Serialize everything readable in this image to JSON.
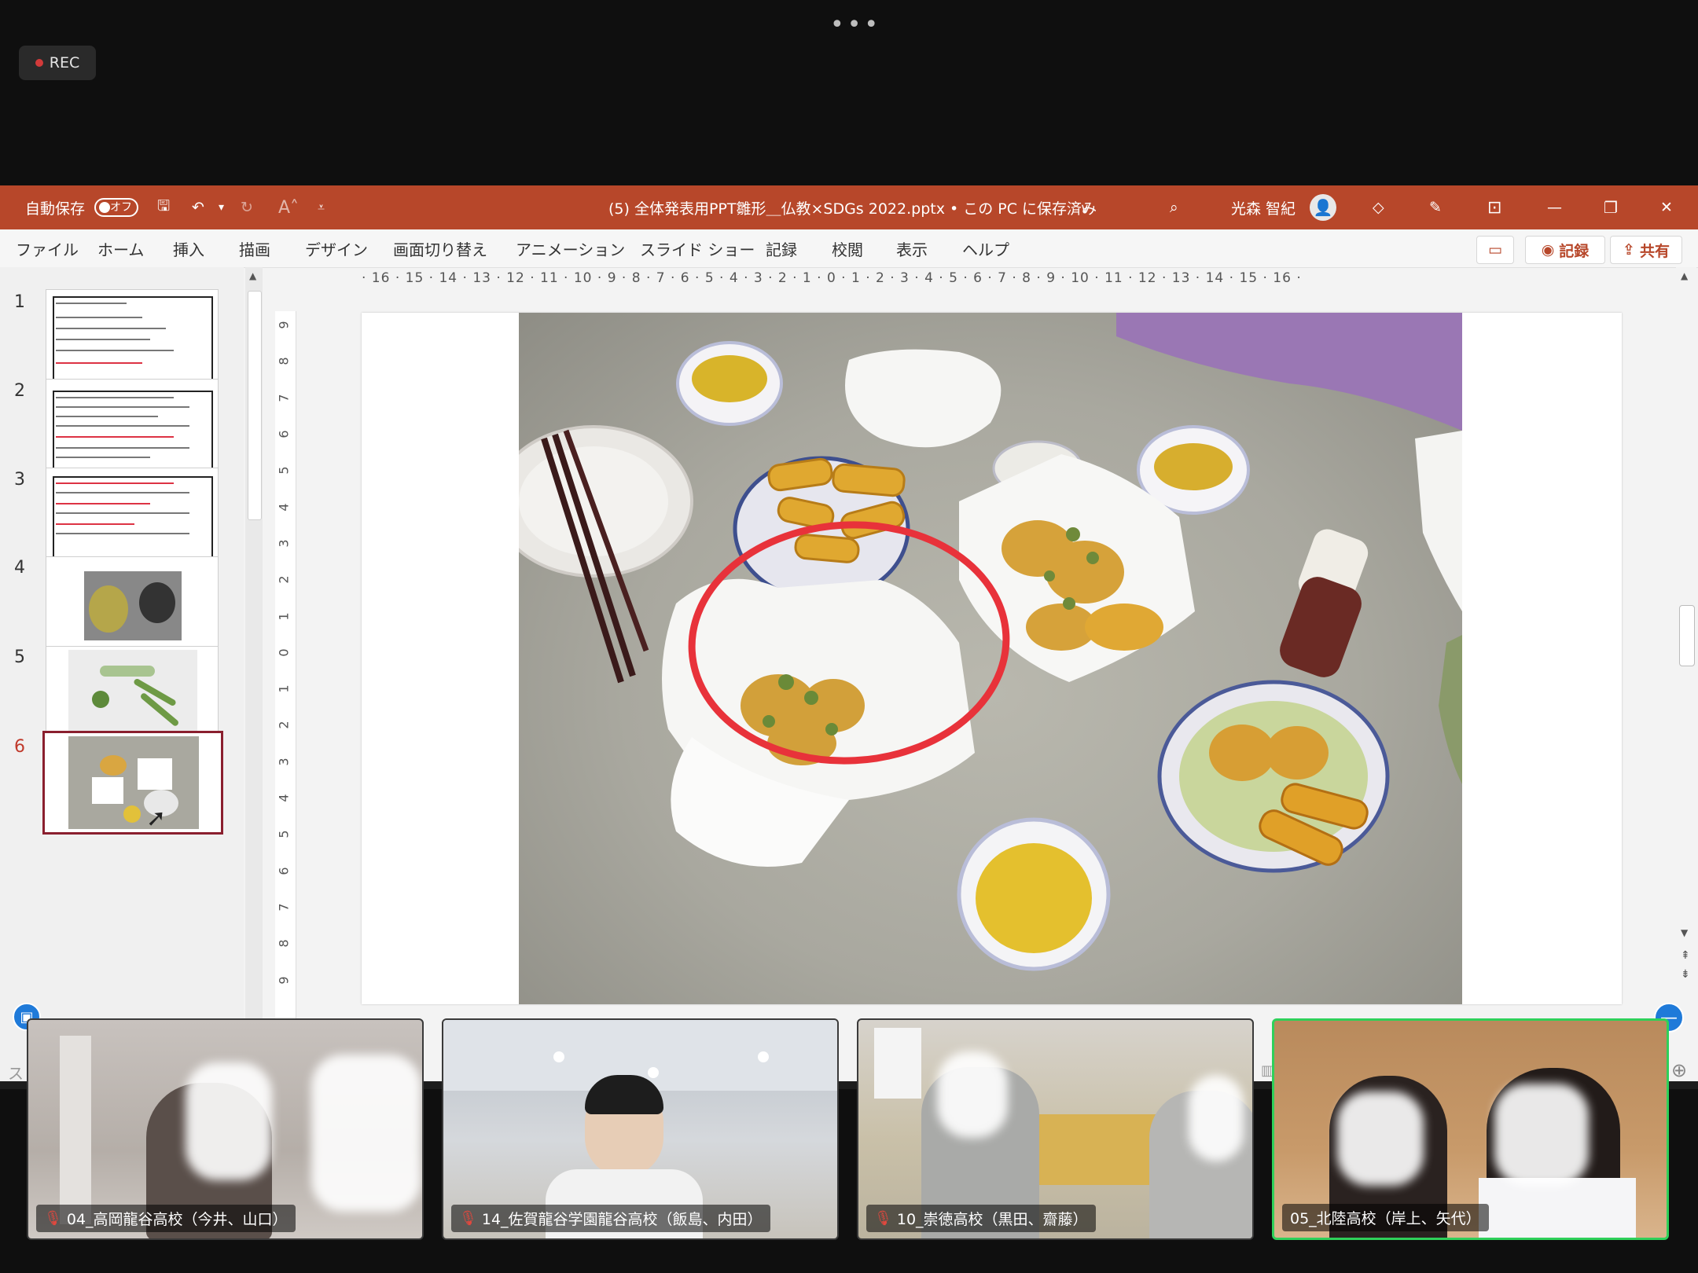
{
  "meeting": {
    "more_icon": "more-dots-icon",
    "more_label": "•••",
    "rec_label": "REC"
  },
  "titlebar": {
    "autosave_label": "自動保存",
    "autosave_state": "オフ",
    "doc_title": "(5) 全体発表用PPT雛形＿仏教×SDGs 2022.pptx • この PC に保存済み",
    "user_name": "光森 智紀"
  },
  "menu": {
    "items": [
      "ファイル",
      "ホーム",
      "挿入",
      "描画",
      "デザイン",
      "画面切り替え",
      "アニメーション",
      "スライド ショー",
      "記録",
      "校閲",
      "表示",
      "ヘルプ"
    ],
    "record_label": "記録",
    "share_label": "共有"
  },
  "ruler": {
    "horizontal": "· 16 · 15 · 14 · 13 · 12 · 11 · 10 · 9 · 8 · 7 · 6 · 5 · 4 · 3 · 2 · 1 · 0 · 1 · 2 · 3 · 4 · 5 · 6 · 7 · 8 · 9 · 10 · 11 · 12 · 13 · 14 · 15 · 16 ·",
    "vertical": [
      "9",
      "8",
      "7",
      "6",
      "5",
      "4",
      "3",
      "2",
      "1",
      "0",
      "1",
      "2",
      "3",
      "4",
      "5",
      "6",
      "7",
      "8",
      "9"
    ]
  },
  "slides": [
    {
      "num": "1",
      "kind": "text"
    },
    {
      "num": "2",
      "kind": "text"
    },
    {
      "num": "3",
      "kind": "text"
    },
    {
      "num": "4",
      "kind": "photo"
    },
    {
      "num": "5",
      "kind": "photo"
    },
    {
      "num": "6",
      "kind": "photo",
      "selected": true
    }
  ],
  "statusbar": {
    "left_text": "ス"
  },
  "participants": [
    {
      "label": "04_高岡龍谷高校（今井、山口）",
      "muted": true
    },
    {
      "label": "14_佐賀龍谷学園龍谷高校（飯島、内田）",
      "muted": true
    },
    {
      "label": "10_崇徳高校（黒田、齋藤）",
      "muted": true
    },
    {
      "label": "05_北陸高校（岸上、矢代）",
      "muted": false,
      "active": true
    }
  ],
  "colors": {
    "ppt_accent": "#b7472a",
    "active_speaker": "#2fd05a",
    "annotation_circle": "#e8323a",
    "selected_slide": "#8a1f2e"
  }
}
